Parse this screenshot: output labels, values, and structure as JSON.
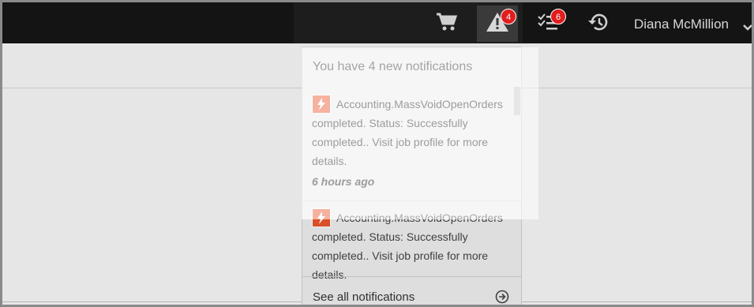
{
  "colors": {
    "topbar": "#141414",
    "badge": "#e11d1d",
    "bolt": "#e8542b"
  },
  "header": {
    "cart_icon": "cart-icon",
    "alerts_icon": "warning-icon",
    "alerts_badge": "4",
    "tasks_icon": "task-list-icon",
    "tasks_badge": "6",
    "history_icon": "history-icon",
    "user_name": "Diana McMillion",
    "user_menu_icon": "chevron-down-icon"
  },
  "notifications": {
    "heading": "You have 4 new notifications",
    "items": [
      {
        "icon": "bolt-icon",
        "text": "Accounting.MassVoidOpenOrders completed. Status: Successfully completed.. Visit job profile for more details.",
        "time": "6 hours ago"
      },
      {
        "icon": "bolt-icon",
        "text": "Accounting.MassVoidOpenOrders completed. Status: Successfully completed.. Visit job profile for more details."
      }
    ],
    "see_all_label": "See all notifications",
    "see_all_icon": "arrow-circle-right-icon"
  }
}
